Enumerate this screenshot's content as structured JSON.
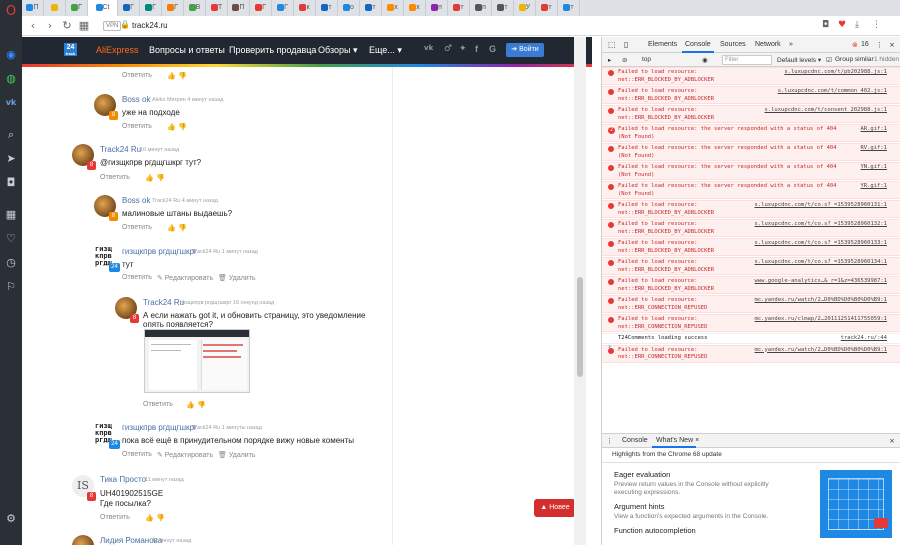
{
  "browser": {
    "url": "track24.ru",
    "vpn_label": "VPN",
    "active_tab_title": "Сt",
    "tabs": [
      {
        "label": "П",
        "color": "#1e88e5"
      },
      {
        "label": "",
        "color": "#f2b300"
      },
      {
        "label": "Г",
        "color": "#43a047"
      },
      {
        "label": "Сt",
        "color": "#1e88e5"
      },
      {
        "label": "Г",
        "color": "#1565c0"
      },
      {
        "label": "Г",
        "color": "#00897b"
      },
      {
        "label": "Г",
        "color": "#f57c00"
      },
      {
        "label": "B",
        "color": "#43a047"
      },
      {
        "label": "T",
        "color": "#e53935"
      },
      {
        "label": "П",
        "color": "#6d4c41"
      },
      {
        "label": "Г",
        "color": "#e53935"
      },
      {
        "label": "Г",
        "color": "#1e88e5"
      },
      {
        "label": "к",
        "color": "#e53935"
      },
      {
        "label": "т",
        "color": "#1565c0"
      },
      {
        "label": "о",
        "color": "#1e88e5"
      },
      {
        "label": "т",
        "color": "#1565c0"
      },
      {
        "label": "х",
        "color": "#fb8c00"
      },
      {
        "label": "х",
        "color": "#fb8c00"
      },
      {
        "label": "п",
        "color": "#8e24aa"
      },
      {
        "label": "т",
        "color": "#e53935"
      },
      {
        "label": "п",
        "color": "#555"
      },
      {
        "label": "т",
        "color": "#555"
      },
      {
        "label": "У",
        "color": "#f2b300"
      },
      {
        "label": "т",
        "color": "#e53935"
      },
      {
        "label": "т",
        "color": "#1e88e5"
      }
    ]
  },
  "sidebar_icons": [
    "opera-logo",
    "messenger-icon",
    "whatsapp-icon",
    "vk-icon",
    "search-icon",
    "send-icon",
    "camera-icon",
    "apps-icon",
    "heart-icon",
    "history-icon",
    "extensions-icon",
    "settings-icon"
  ],
  "site": {
    "logo_num": "24",
    "logo_sub": "track",
    "ali_label": "AliExpress",
    "nav": {
      "qa": "Вопросы и ответы",
      "check": "Проверить продавца",
      "reviews": "Обзоры ▾",
      "more": "Еще... ▾"
    },
    "social": {
      "vk": "vk",
      "ok": "ok",
      "tw": "tw",
      "fb": "f",
      "g": "G"
    },
    "login": "➔ Войти",
    "newer_button": "▲ Новее"
  },
  "comments": {
    "c0": {
      "reply": "Ответить",
      "likes": "👍 👎"
    },
    "c1": {
      "name": "Boss ok",
      "meta": "Aleks Мягрин 4 минут назад",
      "text": "уже на подходе",
      "reply": "Ответить",
      "badge": "8",
      "likes": "👍 👎"
    },
    "c2": {
      "name": "Track24 Ru",
      "meta": "10 минут назад",
      "text": "@гизщкпрв ргдщгшкрг тут?",
      "reply": "Ответить",
      "badge": "8",
      "likes": "👍 👎"
    },
    "c3": {
      "name": "Boss ok",
      "meta": "Track24 Ru 4 минут назад",
      "text": "малиновые штаны выдаешь?",
      "reply": "Ответить",
      "badge": "8",
      "likes": "👍 👎"
    },
    "c4": {
      "name": "гизщкпрв ргдщгшкрг",
      "meta": "Track24 Ru 1 минут назад",
      "text": "тут",
      "reply": "Ответить",
      "edit": "✎ Редактировать",
      "delete": "🗑 Удалить",
      "avatar": "гизщ кпрв ргдщ",
      "badge": "24",
      "likes": "👍 👎"
    },
    "c5": {
      "name": "Track24 Ru",
      "meta": "гизщкпрв ргдщгшкрг 16 секунд назад",
      "text1": "А если нажать got it, и обновить страницу, это уведомление",
      "text2": "опять появляется?",
      "reply": "Ответить",
      "badge": "8",
      "likes": "👍 👎"
    },
    "c6": {
      "name": "гизщкпрв ргдщгшкрг",
      "meta": "Track24 Ru 1 минуты назад",
      "text": "пока всё ещё в принудительном порядке вижу новые коменты",
      "reply": "Ответить",
      "edit": "✎ Редактировать",
      "delete": "🗑 Удалить",
      "avatar": "гизщ кпрв ргдщ",
      "badge": "24",
      "likes": "👍 👎"
    },
    "c7": {
      "name": "Тика Просто",
      "meta": "11 минут назад",
      "text1": "UH401902515GE",
      "text2": "Где посылка?",
      "reply": "Ответить",
      "avatar": "IS",
      "badge": "8",
      "likes": "👍 👎"
    },
    "c8": {
      "name": "Лидия Романова",
      "meta": "12 минут назад"
    }
  },
  "devtools": {
    "tabs": {
      "elements": "Elements",
      "console": "Console",
      "sources": "Sources",
      "network": "Network",
      "more": "»"
    },
    "error_count": "16",
    "context": "top",
    "filter_placeholder": "Filter",
    "levels": "Default levels ▾",
    "group_similar": "Group similar",
    "hidden": "1 hidden",
    "messages": [
      {
        "text": "Failed to load resource:\nnet::ERR_BLOCKED_BY_ADBLOCKER",
        "source": "s.luxupcdnc.com/t/pb202988.js:1"
      },
      {
        "text": "Failed to load resource:\nnet::ERR_BLOCKED_BY_ADBLOCKER",
        "source": "s.luxupcdnc.com/t/common 402.js:1"
      },
      {
        "text": "Failed to load resource:\nnet::ERR_BLOCKED_BY_ADBLOCKER",
        "source": "s.luxupcdnc.com/t/consent 202988.js:1"
      },
      {
        "text": "Failed to load resource: the server responded with a status of 404\n(Not Found)",
        "source": "AR.gif:1",
        "count": "2"
      },
      {
        "text": "Failed to load resource: the server responded with a status of 404\n(Not Found)",
        "source": "RV.gif:1"
      },
      {
        "text": "Failed to load resource: the server responded with a status of 404\n(Not Found)",
        "source": "YN.gif:1"
      },
      {
        "text": "Failed to load resource: the server responded with a status of 404\n(Not Found)",
        "source": "YR.gif:1"
      },
      {
        "text": "Failed to load resource:\nnet::ERR_BLOCKED_BY_ADBLOCKER",
        "source": "s.luxupcdnc.com/t/co.s?_=1539528960131:1"
      },
      {
        "text": "Failed to load resource:\nnet::ERR_BLOCKED_BY_ADBLOCKER",
        "source": "s.luxupcdnc.com/t/co.s?_=1539528960132:1"
      },
      {
        "text": "Failed to load resource:\nnet::ERR_BLOCKED_BY_ADBLOCKER",
        "source": "s.luxupcdnc.com/t/co.s?_=1539528960133:1"
      },
      {
        "text": "Failed to load resource:\nnet::ERR_BLOCKED_BY_ADBLOCKER",
        "source": "s.luxupcdnc.com/t/co.s?_=1539528960134:1"
      },
      {
        "text": "Failed to load resource:\nnet::ERR_BLOCKED_BY_ADBLOCKER",
        "source": "www.google-analytics…& r=1&z=436539987:1"
      },
      {
        "text": "Failed to load resource:\nnet::ERR_CONNECTION_REFUSED",
        "source": "mc.yandex.ru/watch/2…D0%BD%D0%B0%D0%B9:1"
      },
      {
        "text": "Failed to load resource:\nnet::ERR_CONNECTION_REFUSED",
        "source": "mc.yandex.ru/clmap/2…20111251411755059:1"
      },
      {
        "text": "T24Comments loading success",
        "source": "track24.ru/:44",
        "ok": true
      },
      {
        "text": "Failed to load resource:\nnet::ERR_CONNECTION_REFUSED",
        "source": "mc.yandex.ru/watch/2…D0%BD%D0%B0%D0%B9:1"
      }
    ],
    "prompt": "›",
    "drawer": {
      "console_tab": "Console",
      "whats_new_tab": "What's New ×",
      "highlights": "Highlights from the Chrome 68 update",
      "items": [
        {
          "title": "Eager evaluation",
          "desc1": "Preview return values in the Console without explicitly",
          "desc2": "executing expressions."
        },
        {
          "title": "Argument hints",
          "desc1": "View a function's expected arguments in the Console."
        },
        {
          "title": "Function autocompletion"
        }
      ]
    }
  }
}
